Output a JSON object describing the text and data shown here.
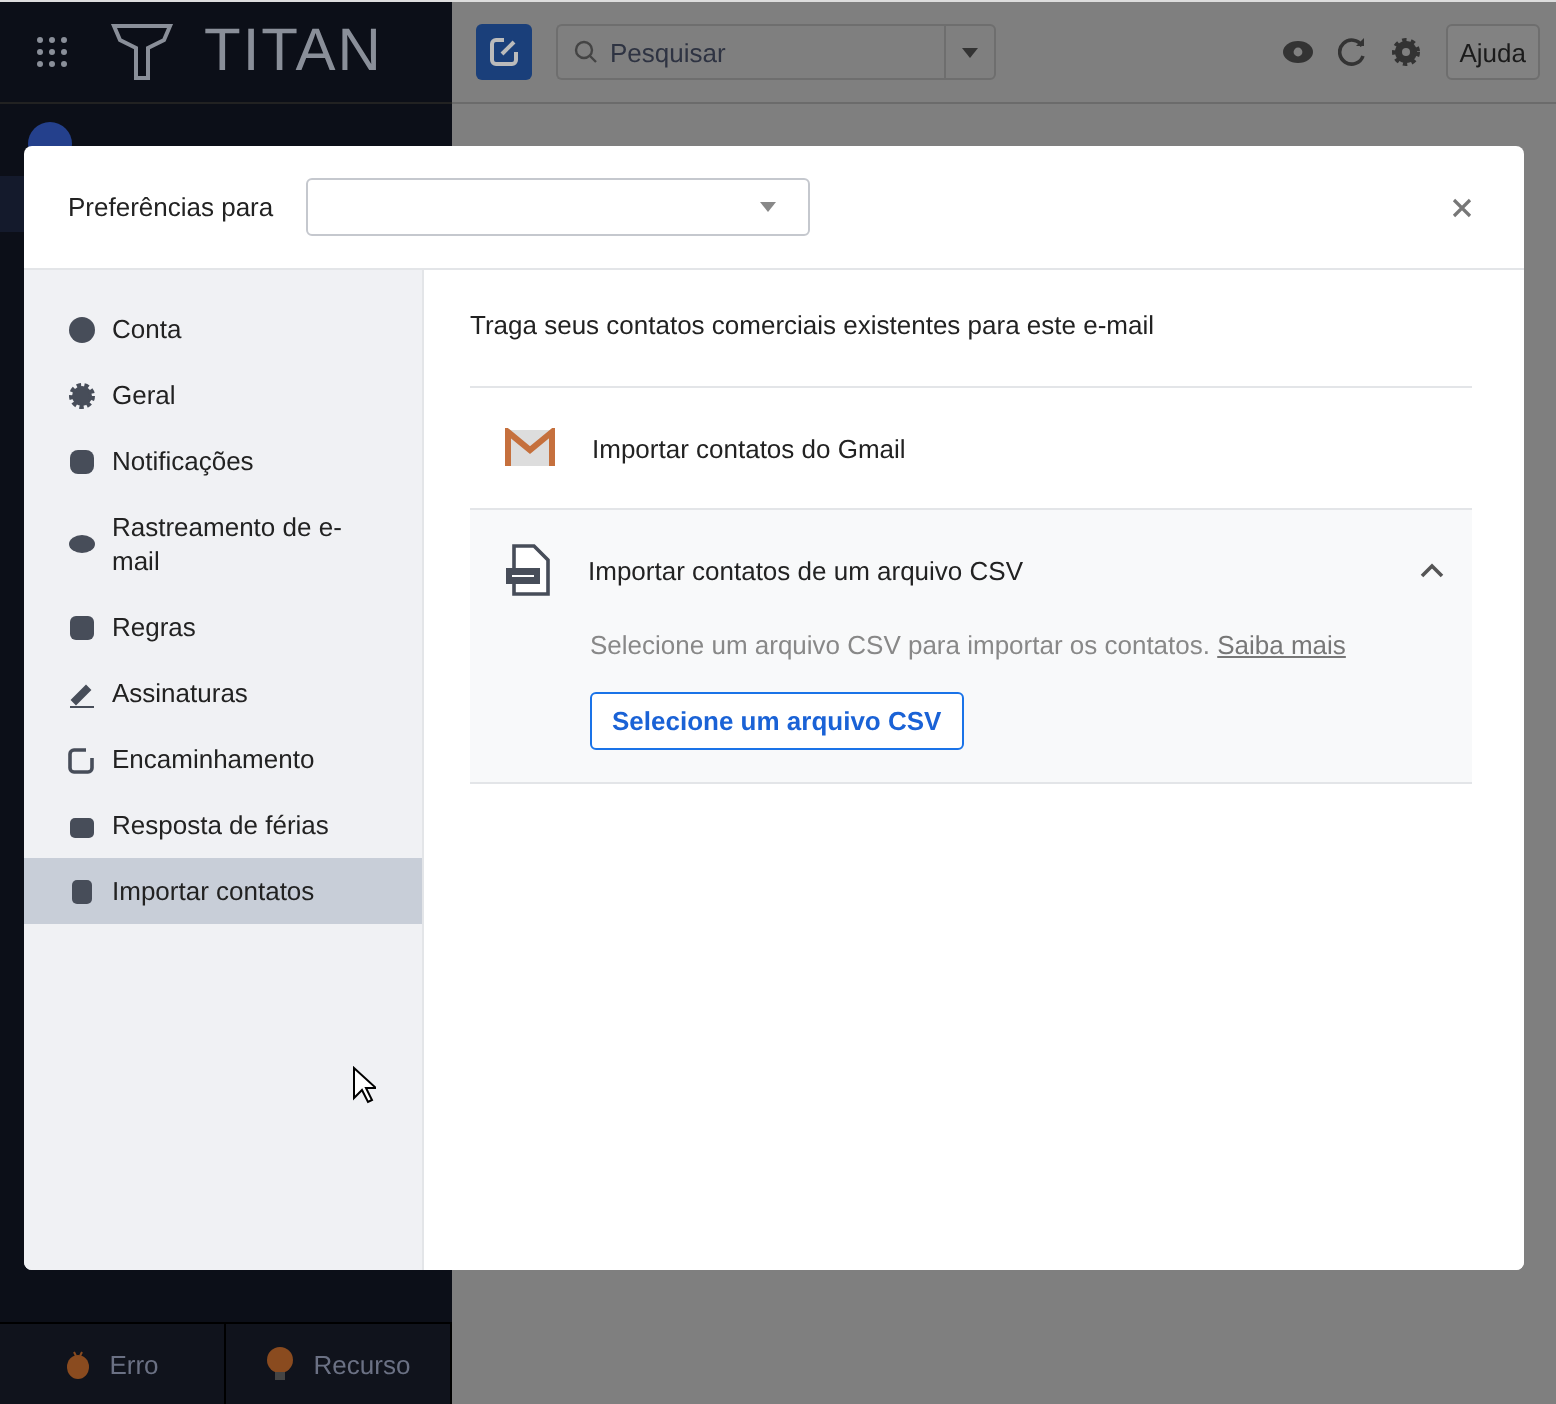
{
  "app": {
    "logo": "TITAN"
  },
  "toolbar": {
    "search": {
      "placeholder": "Pesquisar"
    },
    "help_button": "Ajuda"
  },
  "footer": [
    {
      "label": "Erro"
    },
    {
      "label": "Recurso"
    }
  ],
  "dialog": {
    "title": "Preferências para",
    "nav": [
      {
        "label": "Conta",
        "selected": false
      },
      {
        "label": "Geral",
        "selected": false
      },
      {
        "label": "Notificações",
        "selected": false
      },
      {
        "label": "Rastreamento de e-mail",
        "selected": false
      },
      {
        "label": "Regras",
        "selected": false
      },
      {
        "label": "Assinaturas",
        "selected": false
      },
      {
        "label": "Encaminhamento",
        "selected": false
      },
      {
        "label": "Resposta de férias",
        "selected": false
      },
      {
        "label": "Importar contatos",
        "selected": true
      }
    ],
    "intro": "Traga seus contatos comerciais existentes para este e-mail",
    "import_options": [
      {
        "kind": "gmail",
        "label": "Importar contatos do Gmail"
      },
      {
        "kind": "csv",
        "label": "Importar contatos de um arquivo CSV",
        "expanded": true,
        "description": "Selecione um arquivo CSV para importar os contatos.",
        "link": "Saiba mais",
        "button": "Selecione um arquivo CSV"
      }
    ]
  }
}
